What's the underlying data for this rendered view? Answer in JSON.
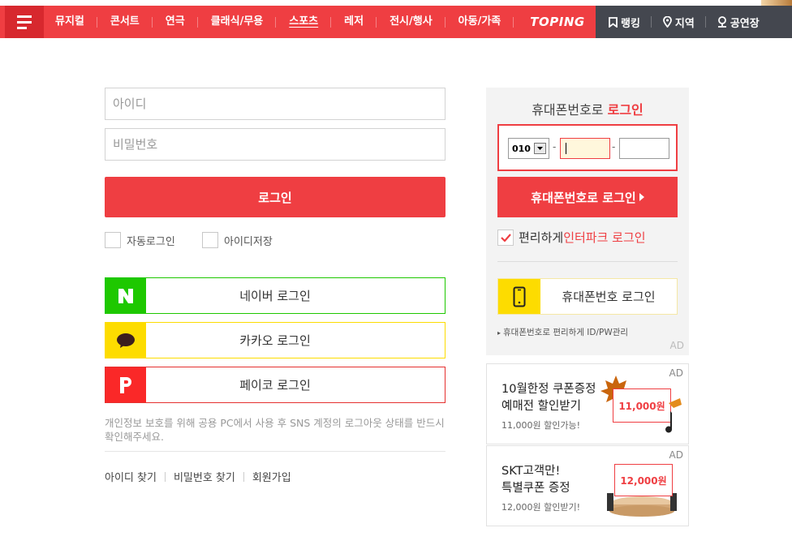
{
  "nav": {
    "categories": [
      "뮤지컬",
      "콘서트",
      "연극",
      "클래식/무용",
      "스포츠",
      "레저",
      "전시/행사",
      "아동/가족"
    ],
    "toping": "TOPING",
    "right_items": [
      "랭킹",
      "지역",
      "공연장"
    ]
  },
  "login": {
    "id_placeholder": "아이디",
    "pw_placeholder": "비밀번호",
    "login_label": "로그인",
    "auto_login": "자동로그인",
    "save_id": "아이디저장",
    "naver_label": "네이버 로그인",
    "kakao_label": "카카오 로그인",
    "payco_label": "페이코 로그인",
    "notice": "개인정보 보호를 위해 공용 PC에서 사용 후 SNS 계정의 로그아웃 상태를 반드시 확인해주세요.",
    "links": [
      "아이디 찾기",
      "비밀번호 찾기",
      "회원가입"
    ]
  },
  "phone": {
    "title_prefix": "휴대폰번호로 ",
    "title_highlight": "로그인",
    "prefix_value": "010",
    "dash": "-",
    "button_label": "휴대폰번호로 로그인",
    "easy_prefix": "편리하게 ",
    "easy_highlight": "인터파크 로그인",
    "phone_login_label": "휴대폰번호 로그인",
    "mgmt_text": "휴대폰번호로 편리하게 ID/PW관리",
    "ad_tag": "AD"
  },
  "ads": [
    {
      "line1": "10월한정 쿠폰증정",
      "line2": "예매전 할인받기",
      "sub": "11,000원 할인가능!",
      "coupon": "11,000원",
      "tag": "AD"
    },
    {
      "line1": "SKT고객만!",
      "line2": "특별쿠폰 증정",
      "sub": "12,000원 할인받기!",
      "coupon": "12,000원",
      "tag": "AD"
    }
  ],
  "colors": {
    "brand_red": "#ef3e42",
    "dark_nav": "#44474f",
    "naver_green": "#1ec800",
    "kakao_yellow": "#fddc00",
    "payco_red": "#fa2828"
  }
}
